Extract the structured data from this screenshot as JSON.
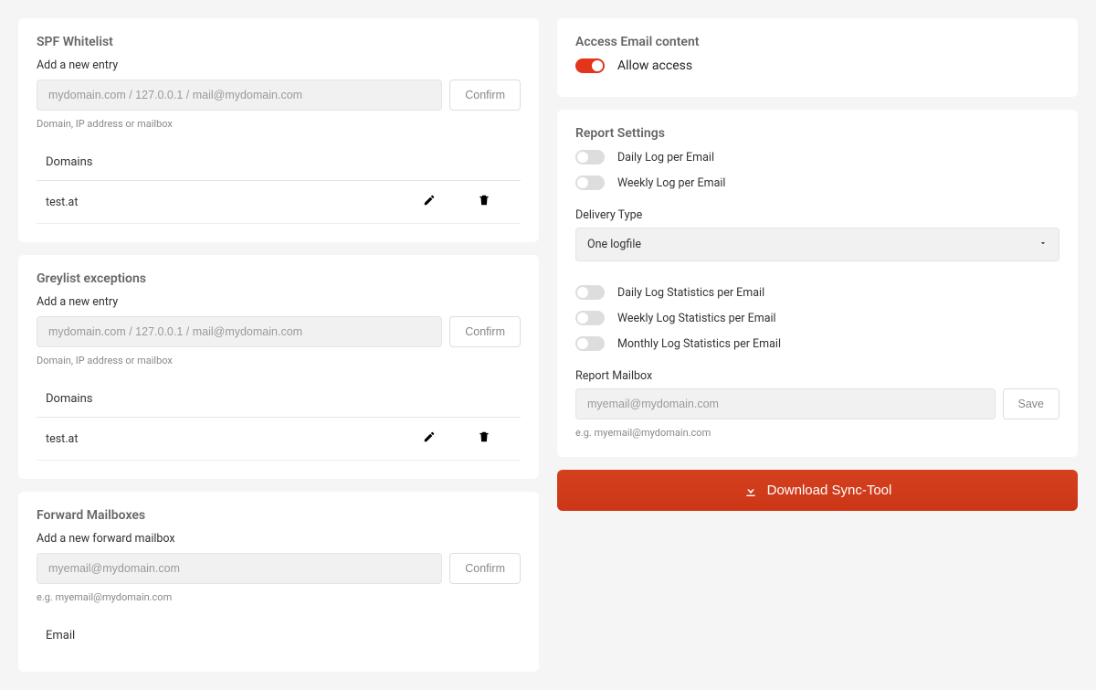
{
  "spf": {
    "title": "SPF Whitelist",
    "addLabel": "Add a new entry",
    "placeholder": "mydomain.com / 127.0.0.1 / mail@mydomain.com",
    "confirm": "Confirm",
    "hint": "Domain, IP address or mailbox",
    "domainsHeader": "Domains",
    "rows": [
      {
        "name": "test.at"
      }
    ]
  },
  "greylist": {
    "title": "Greylist exceptions",
    "addLabel": "Add a new entry",
    "placeholder": "mydomain.com / 127.0.0.1 / mail@mydomain.com",
    "confirm": "Confirm",
    "hint": "Domain, IP address or mailbox",
    "domainsHeader": "Domains",
    "rows": [
      {
        "name": "test.at"
      }
    ]
  },
  "forward": {
    "title": "Forward Mailboxes",
    "addLabel": "Add a new forward mailbox",
    "placeholder": "myemail@mydomain.com",
    "confirm": "Confirm",
    "hint": "e.g. myemail@mydomain.com",
    "emailHeader": "Email"
  },
  "access": {
    "title": "Access Email content",
    "allowLabel": "Allow access",
    "allowOn": true
  },
  "report": {
    "title": "Report Settings",
    "toggles1": [
      {
        "label": "Daily Log per Email",
        "on": false
      },
      {
        "label": "Weekly Log per Email",
        "on": false
      }
    ],
    "deliveryTypeLabel": "Delivery Type",
    "deliveryTypeValue": "One logfile",
    "toggles2": [
      {
        "label": "Daily Log Statistics per Email",
        "on": false
      },
      {
        "label": "Weekly Log Statistics per Email",
        "on": false
      },
      {
        "label": "Monthly Log Statistics per Email",
        "on": false
      }
    ],
    "mailboxLabel": "Report Mailbox",
    "mailboxPlaceholder": "myemail@mydomain.com",
    "saveLabel": "Save",
    "mailboxHint": "e.g. myemail@mydomain.com"
  },
  "download": {
    "label": "Download Sync-Tool"
  }
}
